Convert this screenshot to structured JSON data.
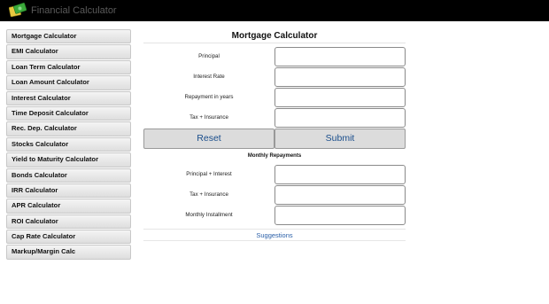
{
  "header": {
    "app_title": "Financial Calculator",
    "logo_icon": "calculator-money-icon"
  },
  "sidebar": {
    "items": [
      {
        "label": "Mortgage Calculator"
      },
      {
        "label": "EMI Calculator"
      },
      {
        "label": "Loan Term Calculator"
      },
      {
        "label": "Loan Amount Calculator"
      },
      {
        "label": "Interest Calculator"
      },
      {
        "label": "Time Deposit Calculator"
      },
      {
        "label": "Rec. Dep. Calculator"
      },
      {
        "label": "Stocks Calculator"
      },
      {
        "label": "Yield to Maturity Calculator"
      },
      {
        "label": "Bonds Calculator"
      },
      {
        "label": "IRR Calculator"
      },
      {
        "label": "APR Calculator"
      },
      {
        "label": "ROI Calculator"
      },
      {
        "label": "Cap Rate Calculator"
      },
      {
        "label": "Markup/Margin Calc"
      }
    ]
  },
  "main": {
    "title": "Mortgage Calculator",
    "inputs": [
      {
        "label": "Principal",
        "value": ""
      },
      {
        "label": "Interest Rate",
        "value": ""
      },
      {
        "label": "Repayment in years",
        "value": ""
      },
      {
        "label": "Tax + Insurance",
        "value": ""
      }
    ],
    "reset_label": "Reset",
    "submit_label": "Submit",
    "results_heading": "Monthly Repayments",
    "outputs": [
      {
        "label": "Principal + Interest",
        "value": ""
      },
      {
        "label": "Tax + Insurance",
        "value": ""
      },
      {
        "label": "Monthly Installment",
        "value": ""
      }
    ],
    "suggestions_label": "Suggestions"
  },
  "colors": {
    "topbar": "#000000",
    "link": "#2a5fa8",
    "button_text": "#1a4e8c"
  }
}
